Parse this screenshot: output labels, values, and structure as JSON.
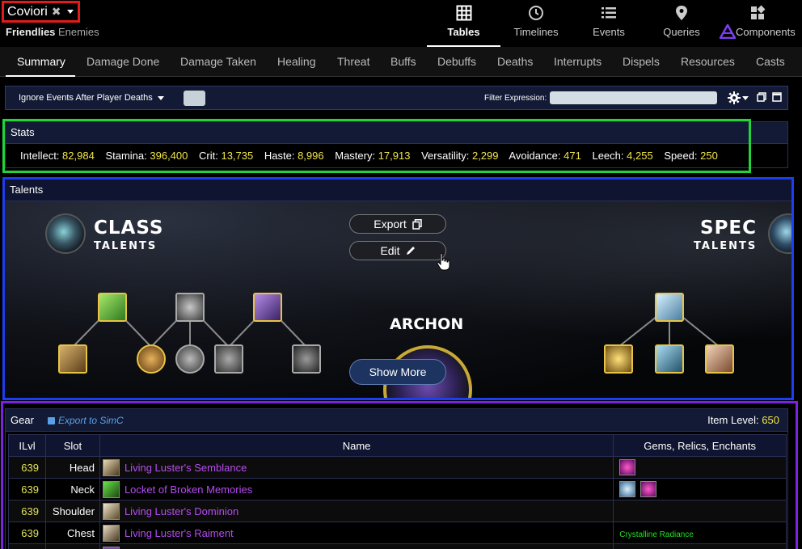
{
  "player": {
    "name": "Coviori",
    "friendlies": "Friendlies",
    "enemies": "Enemies"
  },
  "nav": [
    {
      "label": "Tables",
      "icon": "table-icon"
    },
    {
      "label": "Timelines",
      "icon": "clock-icon"
    },
    {
      "label": "Events",
      "icon": "list-icon"
    },
    {
      "label": "Queries",
      "icon": "map-pin-icon"
    },
    {
      "label": "Components",
      "icon": "components-icon"
    }
  ],
  "tabs": [
    "Summary",
    "Damage Done",
    "Damage Taken",
    "Healing",
    "Threat",
    "Buffs",
    "Debuffs",
    "Deaths",
    "Interrupts",
    "Dispels",
    "Resources",
    "Casts"
  ],
  "filter": {
    "ignore_label": "Ignore Events After Player Deaths",
    "expression_label": "Filter Expression:",
    "expression_value": ""
  },
  "stats": {
    "title": "Stats",
    "items": [
      {
        "label": "Intellect:",
        "value": "82,984"
      },
      {
        "label": "Stamina:",
        "value": "396,400"
      },
      {
        "label": "Crit:",
        "value": "13,735"
      },
      {
        "label": "Haste:",
        "value": "8,996"
      },
      {
        "label": "Mastery:",
        "value": "17,913"
      },
      {
        "label": "Versatility:",
        "value": "2,299"
      },
      {
        "label": "Avoidance:",
        "value": "471"
      },
      {
        "label": "Leech:",
        "value": "4,255"
      },
      {
        "label": "Speed:",
        "value": "250"
      }
    ]
  },
  "talents": {
    "title": "Talents",
    "class_big": "CLASS",
    "class_small": "TALENTS",
    "spec_big": "SPEC",
    "spec_small": "TALENTS",
    "export_label": "Export",
    "edit_label": "Edit",
    "hero_name": "ARCHON",
    "show_more": "Show More"
  },
  "gear": {
    "title": "Gear",
    "export_simc": "Export to SimC",
    "item_level_label": "Item Level:",
    "item_level": "650",
    "columns": [
      "ILvl",
      "Slot",
      "Name",
      "Gems, Relics, Enchants"
    ],
    "rows": [
      {
        "ilvl": "639",
        "slot": "Head",
        "name": "Living Luster's Semblance",
        "gems": [
          "purple-gem"
        ],
        "enchant": ""
      },
      {
        "ilvl": "639",
        "slot": "Neck",
        "name": "Locket of Broken Memories",
        "gems": [
          "blue-gem",
          "purple-gem"
        ],
        "enchant": ""
      },
      {
        "ilvl": "639",
        "slot": "Shoulder",
        "name": "Living Luster's Dominion",
        "gems": [],
        "enchant": ""
      },
      {
        "ilvl": "639",
        "slot": "Chest",
        "name": "Living Luster's Raiment",
        "gems": [],
        "enchant": "Crystalline Radiance"
      }
    ]
  },
  "colors": {
    "stats_highlight": "#22d43a",
    "talents_highlight": "#1c3df0",
    "gear_highlight": "#7a22e0",
    "player_highlight": "#e01b1b",
    "stat_value": "#f0e44a",
    "item_epic": "#b64cf0"
  }
}
